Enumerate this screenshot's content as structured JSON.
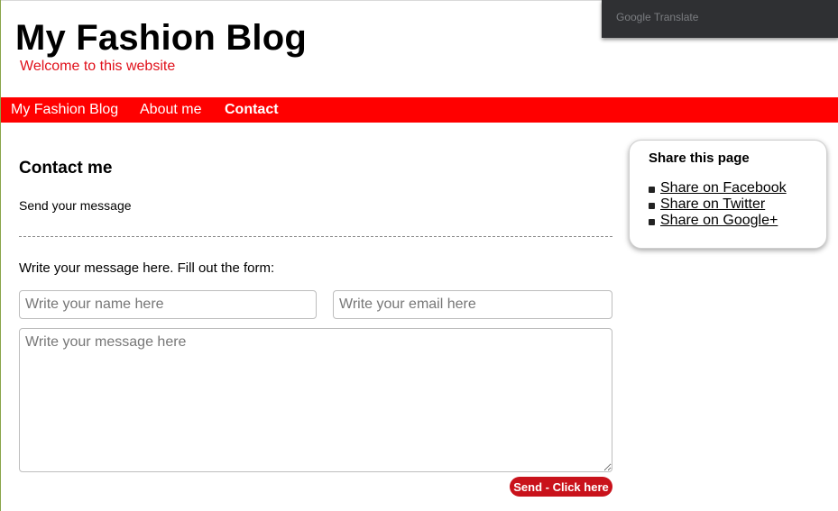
{
  "header": {
    "site_title": "My Fashion Blog",
    "tagline": "Welcome to this website"
  },
  "translate_widget": {
    "label": "Google Translate"
  },
  "nav": {
    "items": [
      {
        "label": "My Fashion Blog",
        "active": false
      },
      {
        "label": "About me",
        "active": false
      },
      {
        "label": "Contact",
        "active": true
      }
    ]
  },
  "main": {
    "heading": "Contact me",
    "subheading": "Send your message",
    "form_intro": "Write your message here. Fill out the form:",
    "form": {
      "name_placeholder": "Write your name here",
      "name_value": "",
      "email_placeholder": "Write your email here",
      "email_value": "",
      "message_placeholder": "Write your message here",
      "message_value": "",
      "submit_label": "Send - Click here"
    }
  },
  "share": {
    "title": "Share this page",
    "links": [
      {
        "label": "Share on Facebook",
        "icon": "facebook-icon"
      },
      {
        "label": "Share on Twitter",
        "icon": "twitter-icon"
      },
      {
        "label": "Share on Google+",
        "icon": "google-plus-icon"
      }
    ]
  },
  "colors": {
    "nav_background": "#ff0000",
    "tagline": "#e0101a",
    "button": "#c9121b",
    "translate_bar": "#2f3033"
  }
}
